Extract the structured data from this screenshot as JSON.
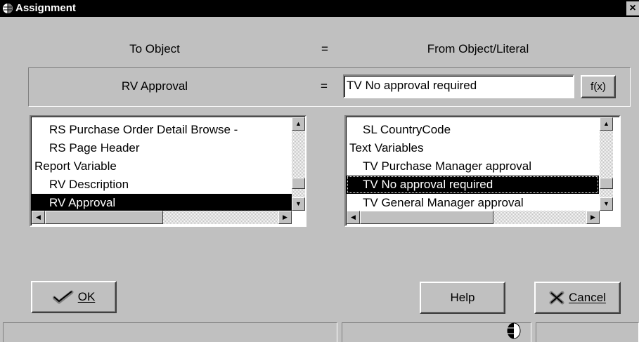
{
  "window": {
    "title": "Assignment",
    "close": "×"
  },
  "headers": {
    "to": "To Object",
    "eq": "=",
    "from": "From Object/Literal"
  },
  "assignment": {
    "to_value": "RV Approval",
    "eq": "=",
    "from_value": "TV No approval required",
    "fx_label": "f(x)"
  },
  "left_list": {
    "items": [
      {
        "label": "RS Purchase Order Detail Browse -",
        "indent": true,
        "selected": false
      },
      {
        "label": "RS Page Header",
        "indent": true,
        "selected": false
      },
      {
        "label": "Report Variable",
        "indent": false,
        "selected": false
      },
      {
        "label": "RV Description",
        "indent": true,
        "selected": false
      },
      {
        "label": "RV Approval",
        "indent": true,
        "selected": true
      }
    ]
  },
  "right_list": {
    "items": [
      {
        "label": "SL CountryCode",
        "indent": true,
        "selected": false
      },
      {
        "label": "Text Variables",
        "indent": false,
        "selected": false
      },
      {
        "label": "TV Purchase Manager approval",
        "indent": true,
        "selected": false
      },
      {
        "label": "TV No approval required",
        "indent": true,
        "selected": true
      },
      {
        "label": "TV General Manager approval",
        "indent": true,
        "selected": false
      }
    ]
  },
  "buttons": {
    "ok": "OK",
    "help": "Help",
    "cancel": "Cancel"
  },
  "icons": {
    "ok": "checkmark-icon",
    "cancel": "cross-icon",
    "status": "globe-icon",
    "title": "app-icon"
  }
}
